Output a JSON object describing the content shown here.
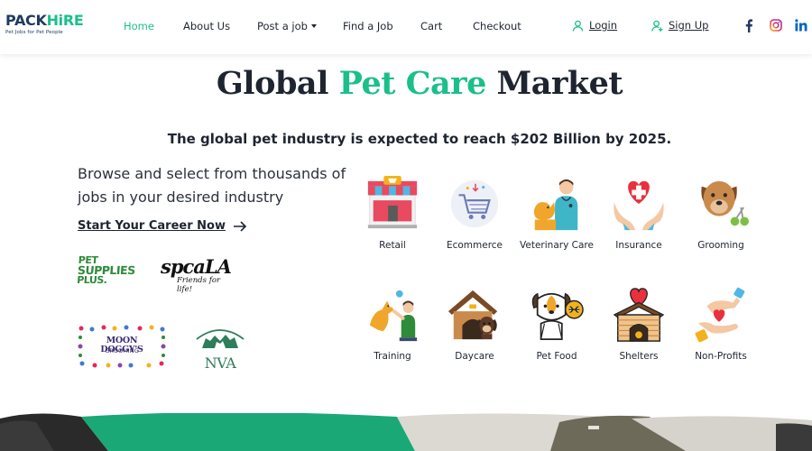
{
  "brand": {
    "name_part1": "PACK",
    "name_part2": "HiRE",
    "tagline": "Pet Jobs for Pet People",
    "primary_color": "#1f3b63",
    "accent_color": "#1bbf8a"
  },
  "nav": {
    "items": [
      {
        "label": "Home",
        "active": true
      },
      {
        "label": "About Us",
        "active": false
      },
      {
        "label": "Post a job",
        "active": false,
        "dropdown": true
      },
      {
        "label": "Find a Job",
        "active": false
      },
      {
        "label": "Cart",
        "active": false
      },
      {
        "label": "Checkout",
        "active": false
      }
    ],
    "login_label": "Login",
    "signup_label": "Sign Up",
    "social_icons": [
      "facebook-icon",
      "instagram-icon",
      "linkedin-icon"
    ]
  },
  "hero": {
    "title_part1": "Global ",
    "title_accent": "Pet Care",
    "title_part2": " Market",
    "subtitle": "The global pet industry is expected to reach $202 Billion by 2025.",
    "lead": "Browse and select from thousands of jobs in your desired industry",
    "cta_label": "Start Your Career Now"
  },
  "partners": {
    "petsupplies_line1": "PET",
    "petsupplies_line2": "SUPPLIES",
    "petsupplies_line3": "PLUS.",
    "spca_name": "spcaLA",
    "spca_tagline": "Friends for life!",
    "moondoggys_line1": "MOON DOGGY'S",
    "moondoggys_line2": "GROOMING",
    "nva_name": "NVA"
  },
  "industries": [
    {
      "label": "Retail",
      "icon": "retail-store-icon"
    },
    {
      "label": "Ecommerce",
      "icon": "shopping-cart-icon"
    },
    {
      "label": "Veterinary Care",
      "icon": "veterinarian-icon"
    },
    {
      "label": "Insurance",
      "icon": "heart-hands-icon"
    },
    {
      "label": "Grooming",
      "icon": "dog-grooming-icon"
    },
    {
      "label": "Training",
      "icon": "dog-training-icon"
    },
    {
      "label": "Daycare",
      "icon": "dog-house-icon"
    },
    {
      "label": "Pet Food",
      "icon": "pet-food-icon"
    },
    {
      "label": "Shelters",
      "icon": "shelter-icon"
    },
    {
      "label": "Non-Profits",
      "icon": "donation-icon"
    }
  ]
}
